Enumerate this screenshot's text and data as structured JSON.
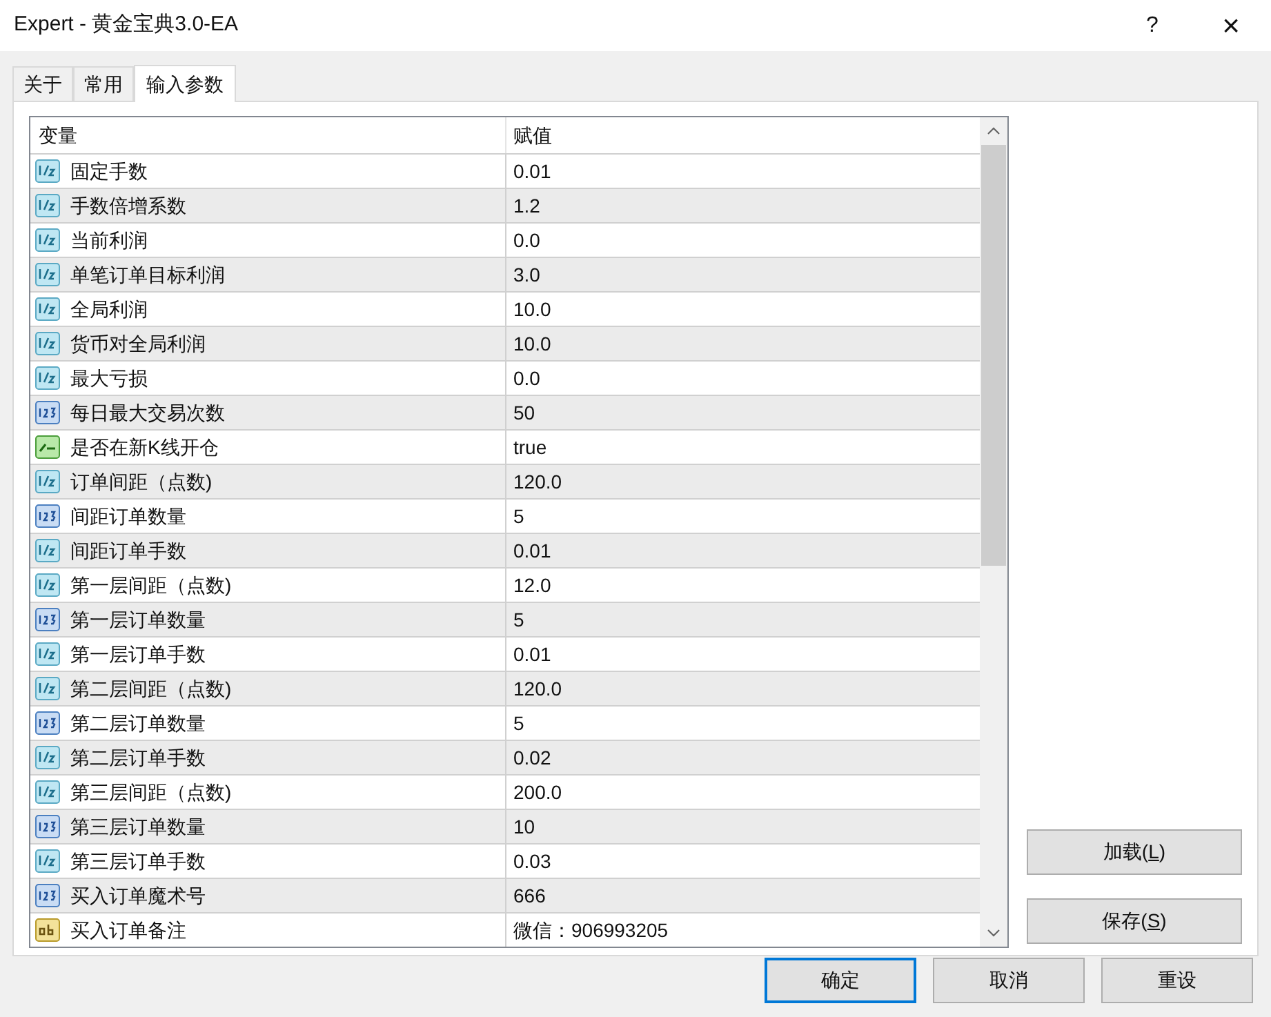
{
  "window": {
    "title": "Expert - 黄金宝典3.0-EA",
    "help": "?",
    "close": "×"
  },
  "tabs": [
    {
      "label": "关于",
      "selected": false
    },
    {
      "label": "常用",
      "selected": false
    },
    {
      "label": "输入参数",
      "selected": true
    }
  ],
  "table": {
    "columns": [
      "变量",
      "赋值"
    ],
    "rows": [
      {
        "kind": "double",
        "name": "固定手数",
        "value": "0.01"
      },
      {
        "kind": "double",
        "name": "手数倍增系数",
        "value": "1.2"
      },
      {
        "kind": "double",
        "name": "当前利润",
        "value": "0.0"
      },
      {
        "kind": "double",
        "name": "单笔订单目标利润",
        "value": "3.0"
      },
      {
        "kind": "double",
        "name": "全局利润",
        "value": "10.0"
      },
      {
        "kind": "double",
        "name": "货币对全局利润",
        "value": "10.0"
      },
      {
        "kind": "double",
        "name": "最大亏损",
        "value": "0.0"
      },
      {
        "kind": "int",
        "name": "每日最大交易次数",
        "value": "50"
      },
      {
        "kind": "bool",
        "name": "是否在新K线开仓",
        "value": "true"
      },
      {
        "kind": "double",
        "name": "订单间距（点数)",
        "value": "120.0"
      },
      {
        "kind": "int",
        "name": "间距订单数量",
        "value": "5"
      },
      {
        "kind": "double",
        "name": "间距订单手数",
        "value": "0.01"
      },
      {
        "kind": "double",
        "name": "第一层间距（点数)",
        "value": "12.0"
      },
      {
        "kind": "int",
        "name": "第一层订单数量",
        "value": "5"
      },
      {
        "kind": "double",
        "name": "第一层订单手数",
        "value": "0.01"
      },
      {
        "kind": "double",
        "name": "第二层间距（点数)",
        "value": "120.0"
      },
      {
        "kind": "int",
        "name": "第二层订单数量",
        "value": "5"
      },
      {
        "kind": "double",
        "name": "第二层订单手数",
        "value": "0.02"
      },
      {
        "kind": "double",
        "name": "第三层间距（点数)",
        "value": "200.0"
      },
      {
        "kind": "int",
        "name": "第三层订单数量",
        "value": "10"
      },
      {
        "kind": "double",
        "name": "第三层订单手数",
        "value": "0.03"
      },
      {
        "kind": "int",
        "name": "买入订单魔术号",
        "value": "666"
      },
      {
        "kind": "string",
        "name": "买入订单备注",
        "value": "微信：906993205"
      }
    ]
  },
  "side_buttons": [
    {
      "label": "加载(",
      "key": "L",
      "end": ")"
    },
    {
      "label": "保存(",
      "key": "S",
      "end": ")"
    }
  ],
  "buttons": [
    {
      "label": "确定",
      "default": true
    },
    {
      "label": "取消",
      "default": false
    },
    {
      "label": "重设",
      "default": false
    }
  ]
}
